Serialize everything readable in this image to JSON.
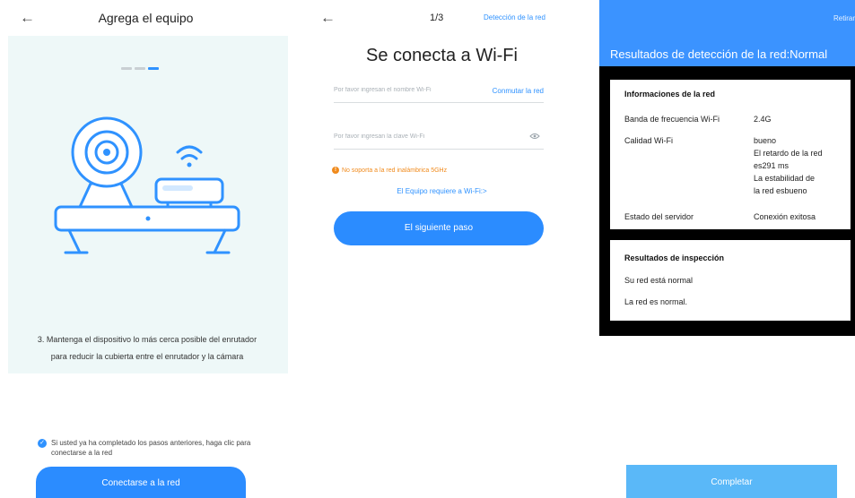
{
  "panel1": {
    "title": "Agrega el equipo",
    "instruction": "3. Mantenga el dispositivo lo más cerca posible del enrutador para reducir la cubierta entre el enrutador y la cámara",
    "confirm_text": "Si usted ya ha completado los pasos anteriores, haga clic para conectarse a la red",
    "connect_button": "Conectarse a la red",
    "colors": {
      "accent": "#2b8cff",
      "card_bg": "#eef8f8"
    }
  },
  "panel2": {
    "step": "1/3",
    "detect_link": "Detección de la red",
    "title": "Se conecta a Wi-Fi",
    "wifi_name_placeholder": "Por favor ingresan el nombre Wi-Fi",
    "switch_network": "Conmutar la red",
    "wifi_password_placeholder": "Por favor ingresan la clave Wi-Fi",
    "warning": "No soporta a la red inalámbrica 5GHz",
    "requirement_link": "El Equipo requiere a Wi-Fi:>",
    "next_button": "El siguiente paso",
    "colors": {
      "warning": "#f08a1c",
      "link": "#2f92ff"
    }
  },
  "panel3": {
    "retirar": "Retirar",
    "heading": "Resultados de detección de la red:Normal",
    "network_info": {
      "title": "Informaciones de la red",
      "band_label": "Banda de frecuencia Wi-Fi",
      "band_value": "2.4G",
      "quality_label": "Calidad Wi-Fi",
      "quality_lines": [
        "bueno",
        "El retardo de la red",
        "es291 ms",
        "La estabilidad de",
        "la red esbueno"
      ],
      "server_label": "Estado del servidor",
      "server_value": "Conexión exitosa"
    },
    "inspection": {
      "title": "Resultados de inspección",
      "line1": "Su red está normal",
      "line2": "La red es normal."
    },
    "done_button": "Completar",
    "colors": {
      "header": "#3b93ff",
      "done": "#5ab8f8"
    }
  }
}
